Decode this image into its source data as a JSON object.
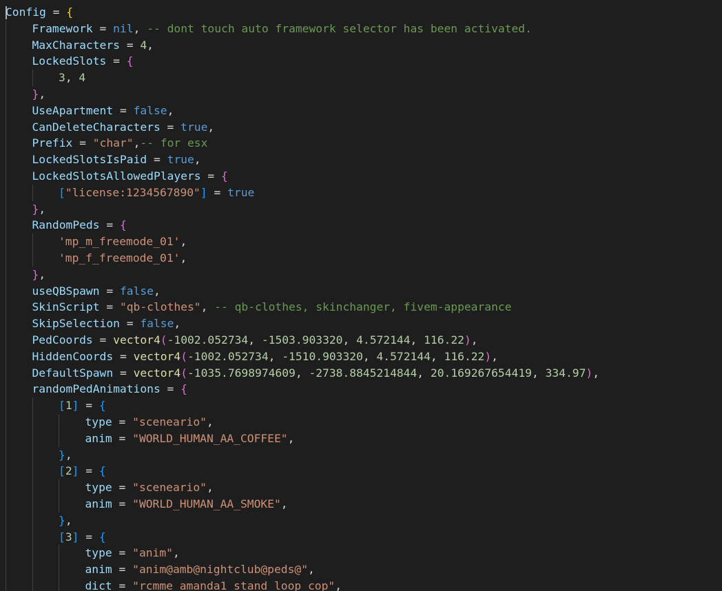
{
  "editor": {
    "language": "lua",
    "theme_colors": {
      "background": "#1e1e1e",
      "identifier": "#9cdcfe",
      "number": "#b5cea8",
      "string": "#ce9178",
      "keyword": "#569cd6",
      "comment": "#6a9955",
      "function": "#dcdcaa",
      "bracket_level_1": "#ffd700",
      "bracket_level_2": "#da70d6",
      "bracket_level_3": "#179fff"
    }
  },
  "code_lines": [
    {
      "indent": 0,
      "cursor": true,
      "tokens": [
        [
          "var",
          "Config"
        ],
        [
          "plain",
          " = "
        ],
        [
          "b1",
          "{"
        ]
      ]
    },
    {
      "indent": 1,
      "tokens": [
        [
          "var",
          "Framework"
        ],
        [
          "plain",
          " = "
        ],
        [
          "kw",
          "nil"
        ],
        [
          "plain",
          ", "
        ],
        [
          "cmt",
          "-- dont touch auto framework selector has been activated."
        ]
      ]
    },
    {
      "indent": 1,
      "tokens": [
        [
          "var",
          "MaxCharacters"
        ],
        [
          "plain",
          " = "
        ],
        [
          "num",
          "4"
        ],
        [
          "plain",
          ","
        ]
      ]
    },
    {
      "indent": 1,
      "tokens": [
        [
          "var",
          "LockedSlots"
        ],
        [
          "plain",
          " = "
        ],
        [
          "b2",
          "{"
        ]
      ]
    },
    {
      "indent": 2,
      "tokens": [
        [
          "num",
          "3"
        ],
        [
          "plain",
          ", "
        ],
        [
          "num",
          "4"
        ]
      ]
    },
    {
      "indent": 1,
      "tokens": [
        [
          "b2",
          "}"
        ],
        [
          "plain",
          ","
        ]
      ]
    },
    {
      "indent": 1,
      "tokens": [
        [
          "var",
          "UseApartment"
        ],
        [
          "plain",
          " = "
        ],
        [
          "kw",
          "false"
        ],
        [
          "plain",
          ","
        ]
      ]
    },
    {
      "indent": 1,
      "tokens": [
        [
          "var",
          "CanDeleteCharacters"
        ],
        [
          "plain",
          " = "
        ],
        [
          "kw",
          "true"
        ],
        [
          "plain",
          ","
        ]
      ]
    },
    {
      "indent": 1,
      "tokens": [
        [
          "var",
          "Prefix"
        ],
        [
          "plain",
          " = "
        ],
        [
          "str",
          "\"char\""
        ],
        [
          "plain",
          ","
        ],
        [
          "cmt",
          "-- for esx"
        ]
      ]
    },
    {
      "indent": 1,
      "tokens": [
        [
          "var",
          "LockedSlotsIsPaid"
        ],
        [
          "plain",
          " = "
        ],
        [
          "kw",
          "true"
        ],
        [
          "plain",
          ","
        ]
      ]
    },
    {
      "indent": 1,
      "tokens": [
        [
          "var",
          "LockedSlotsAllowedPlayers"
        ],
        [
          "plain",
          " = "
        ],
        [
          "b2",
          "{"
        ]
      ]
    },
    {
      "indent": 2,
      "tokens": [
        [
          "b3",
          "["
        ],
        [
          "str",
          "\"license:1234567890\""
        ],
        [
          "b3",
          "]"
        ],
        [
          "plain",
          " = "
        ],
        [
          "kw",
          "true"
        ]
      ]
    },
    {
      "indent": 1,
      "tokens": [
        [
          "b2",
          "}"
        ],
        [
          "plain",
          ","
        ]
      ]
    },
    {
      "indent": 1,
      "tokens": [
        [
          "var",
          "RandomPeds"
        ],
        [
          "plain",
          " = "
        ],
        [
          "b2",
          "{"
        ]
      ]
    },
    {
      "indent": 2,
      "tokens": [
        [
          "str",
          "'mp_m_freemode_01'"
        ],
        [
          "plain",
          ","
        ]
      ]
    },
    {
      "indent": 2,
      "tokens": [
        [
          "str",
          "'mp_f_freemode_01'"
        ],
        [
          "plain",
          ","
        ]
      ]
    },
    {
      "indent": 1,
      "tokens": [
        [
          "b2",
          "}"
        ],
        [
          "plain",
          ","
        ]
      ]
    },
    {
      "indent": 1,
      "tokens": [
        [
          "var",
          "useQBSpawn"
        ],
        [
          "plain",
          " = "
        ],
        [
          "kw",
          "false"
        ],
        [
          "plain",
          ","
        ]
      ]
    },
    {
      "indent": 1,
      "tokens": [
        [
          "var",
          "SkinScript"
        ],
        [
          "plain",
          " = "
        ],
        [
          "str",
          "\"qb-clothes\""
        ],
        [
          "plain",
          ", "
        ],
        [
          "cmt",
          "-- qb-clothes, skinchanger, fivem-appearance"
        ]
      ]
    },
    {
      "indent": 1,
      "tokens": [
        [
          "var",
          "SkipSelection"
        ],
        [
          "plain",
          " = "
        ],
        [
          "kw",
          "false"
        ],
        [
          "plain",
          ","
        ]
      ]
    },
    {
      "indent": 1,
      "tokens": [
        [
          "var",
          "PedCoords"
        ],
        [
          "plain",
          " = "
        ],
        [
          "func",
          "vector4"
        ],
        [
          "b2",
          "("
        ],
        [
          "num",
          "-1002.052734"
        ],
        [
          "plain",
          ", "
        ],
        [
          "num",
          "-1503.903320"
        ],
        [
          "plain",
          ", "
        ],
        [
          "num",
          "4.572144"
        ],
        [
          "plain",
          ", "
        ],
        [
          "num",
          "116.22"
        ],
        [
          "b2",
          ")"
        ],
        [
          "plain",
          ","
        ]
      ]
    },
    {
      "indent": 1,
      "tokens": [
        [
          "var",
          "HiddenCoords"
        ],
        [
          "plain",
          " = "
        ],
        [
          "func",
          "vector4"
        ],
        [
          "b2",
          "("
        ],
        [
          "num",
          "-1002.052734"
        ],
        [
          "plain",
          ", "
        ],
        [
          "num",
          "-1510.903320"
        ],
        [
          "plain",
          ", "
        ],
        [
          "num",
          "4.572144"
        ],
        [
          "plain",
          ", "
        ],
        [
          "num",
          "116.22"
        ],
        [
          "b2",
          ")"
        ],
        [
          "plain",
          ","
        ]
      ]
    },
    {
      "indent": 1,
      "tokens": [
        [
          "var",
          "DefaultSpawn"
        ],
        [
          "plain",
          " = "
        ],
        [
          "func",
          "vector4"
        ],
        [
          "b2",
          "("
        ],
        [
          "num",
          "-1035.7698974609"
        ],
        [
          "plain",
          ", "
        ],
        [
          "num",
          "-2738.8845214844"
        ],
        [
          "plain",
          ", "
        ],
        [
          "num",
          "20.169267654419"
        ],
        [
          "plain",
          ", "
        ],
        [
          "num",
          "334.97"
        ],
        [
          "b2",
          ")"
        ],
        [
          "plain",
          ","
        ]
      ]
    },
    {
      "indent": 1,
      "tokens": [
        [
          "var",
          "randomPedAnimations"
        ],
        [
          "plain",
          " = "
        ],
        [
          "b2",
          "{"
        ]
      ]
    },
    {
      "indent": 2,
      "tokens": [
        [
          "b3",
          "["
        ],
        [
          "num",
          "1"
        ],
        [
          "b3",
          "]"
        ],
        [
          "plain",
          " = "
        ],
        [
          "b3",
          "{"
        ]
      ]
    },
    {
      "indent": 3,
      "tokens": [
        [
          "var",
          "type"
        ],
        [
          "plain",
          " = "
        ],
        [
          "str",
          "\"sceneario\""
        ],
        [
          "plain",
          ","
        ]
      ]
    },
    {
      "indent": 3,
      "tokens": [
        [
          "var",
          "anim"
        ],
        [
          "plain",
          " = "
        ],
        [
          "str",
          "\"WORLD_HUMAN_AA_COFFEE\""
        ],
        [
          "plain",
          ","
        ]
      ]
    },
    {
      "indent": 2,
      "tokens": [
        [
          "b3",
          "}"
        ],
        [
          "plain",
          ","
        ]
      ]
    },
    {
      "indent": 2,
      "tokens": [
        [
          "b3",
          "["
        ],
        [
          "num",
          "2"
        ],
        [
          "b3",
          "]"
        ],
        [
          "plain",
          " = "
        ],
        [
          "b3",
          "{"
        ]
      ]
    },
    {
      "indent": 3,
      "tokens": [
        [
          "var",
          "type"
        ],
        [
          "plain",
          " = "
        ],
        [
          "str",
          "\"sceneario\""
        ],
        [
          "plain",
          ","
        ]
      ]
    },
    {
      "indent": 3,
      "tokens": [
        [
          "var",
          "anim"
        ],
        [
          "plain",
          " = "
        ],
        [
          "str",
          "\"WORLD_HUMAN_AA_SMOKE\""
        ],
        [
          "plain",
          ","
        ]
      ]
    },
    {
      "indent": 2,
      "tokens": [
        [
          "b3",
          "}"
        ],
        [
          "plain",
          ","
        ]
      ]
    },
    {
      "indent": 2,
      "tokens": [
        [
          "b3",
          "["
        ],
        [
          "num",
          "3"
        ],
        [
          "b3",
          "]"
        ],
        [
          "plain",
          " = "
        ],
        [
          "b3",
          "{"
        ]
      ]
    },
    {
      "indent": 3,
      "tokens": [
        [
          "var",
          "type"
        ],
        [
          "plain",
          " = "
        ],
        [
          "str",
          "\"anim\""
        ],
        [
          "plain",
          ","
        ]
      ]
    },
    {
      "indent": 3,
      "tokens": [
        [
          "var",
          "anim"
        ],
        [
          "plain",
          " = "
        ],
        [
          "str",
          "\"anim@amb@nightclub@peds@\""
        ],
        [
          "plain",
          ","
        ]
      ]
    },
    {
      "indent": 3,
      "tokens": [
        [
          "var",
          "dict"
        ],
        [
          "plain",
          " = "
        ],
        [
          "str",
          "\"rcmme_amanda1_stand_loop_cop\""
        ],
        [
          "plain",
          ","
        ]
      ]
    }
  ]
}
